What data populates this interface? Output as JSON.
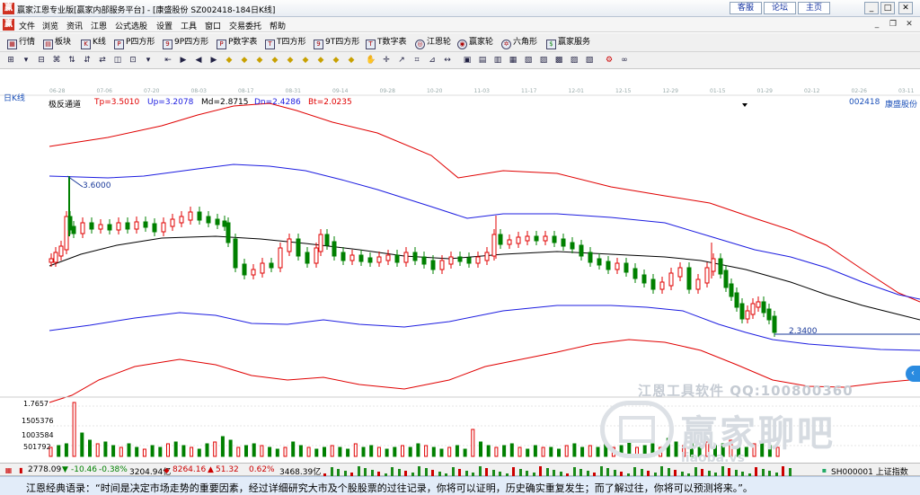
{
  "window": {
    "title": "赢家江恩专业版[赢家内部服务平台] - [康盛股份  SZ002418-184日K线]",
    "links": [
      "客服",
      "论坛",
      "主页"
    ]
  },
  "menu": {
    "items": [
      "文件",
      "浏览",
      "资讯",
      "江恩",
      "公式选股",
      "设置",
      "工具",
      "窗口",
      "交易委托",
      "帮助"
    ]
  },
  "toolbar": {
    "items": [
      {
        "label": "行情",
        "icon": "grid-icon"
      },
      {
        "label": "板块",
        "icon": "blocks-icon"
      },
      {
        "label": "K线",
        "icon": "kline-icon"
      },
      {
        "label": "P四方形",
        "icon": "p-square-icon"
      },
      {
        "label": "9P四方形",
        "icon": "9p-square-icon"
      },
      {
        "label": "P数字表",
        "icon": "p-table-icon"
      },
      {
        "label": "T四方形",
        "icon": "t-square-icon"
      },
      {
        "label": "9T四方形",
        "icon": "9t-square-icon"
      },
      {
        "label": "T数字表",
        "icon": "t-table-icon"
      },
      {
        "label": "江恩轮",
        "icon": "gann-wheel-icon"
      },
      {
        "label": "赢家轮",
        "icon": "winner-wheel-icon"
      },
      {
        "label": "六角形",
        "icon": "hexagon-icon"
      },
      {
        "label": "赢家服务",
        "icon": "service-icon"
      }
    ]
  },
  "chart": {
    "period": "日K线",
    "indicator": {
      "name": "极反通道",
      "tp": "Tp=3.5010",
      "up": "Up=3.2078",
      "md": "Md=2.8715",
      "dn": "Dn=2.4286",
      "bt": "Bt=2.0235"
    },
    "stock_code": "002418",
    "stock_name": "康盛股份",
    "high_label": "3.6000",
    "low_label": "2.3400",
    "volume_axis": [
      "1.7657",
      "1505376",
      "1003584",
      "501792"
    ],
    "date_ticks": [
      "06-28",
      "07-06",
      "07-20",
      "08-03",
      "08-17",
      "08-31",
      "09-14",
      "09-28",
      "10-20",
      "11-03",
      "11-17",
      "12-01",
      "12-15",
      "12-29",
      "01-15",
      "01-29",
      "02-12",
      "02-26",
      "03-11"
    ],
    "colors": {
      "candle_up": "#e00000",
      "candle_down": "#008000",
      "outer_band": "#e00000",
      "inner_band": "#1c1ce0",
      "mid_line": "#000000"
    }
  },
  "watermark": {
    "line1": "江恩工具软件  QQ:100800360",
    "line2": "赢家聊吧",
    "line3": "liaoba.vs"
  },
  "status": {
    "idx1_value": "2778.09",
    "idx1_change": "-10.46",
    "idx1_pct": "-0.38%",
    "idx1_amount": "3204.94亿",
    "idx2_value": "8264.16",
    "idx2_change": "51.32",
    "idx2_pct": "0.62%",
    "idx2_amount": "3468.39亿",
    "right_text": "SH000001 上证指数"
  },
  "quote": "江恩经典语录：“时间是决定市场走势的重要因素，经过详细研究大市及个股股票的过往记录，你将可以证明，历史确实重复发生；而了解过往，你将可以预测将来。”。"
}
